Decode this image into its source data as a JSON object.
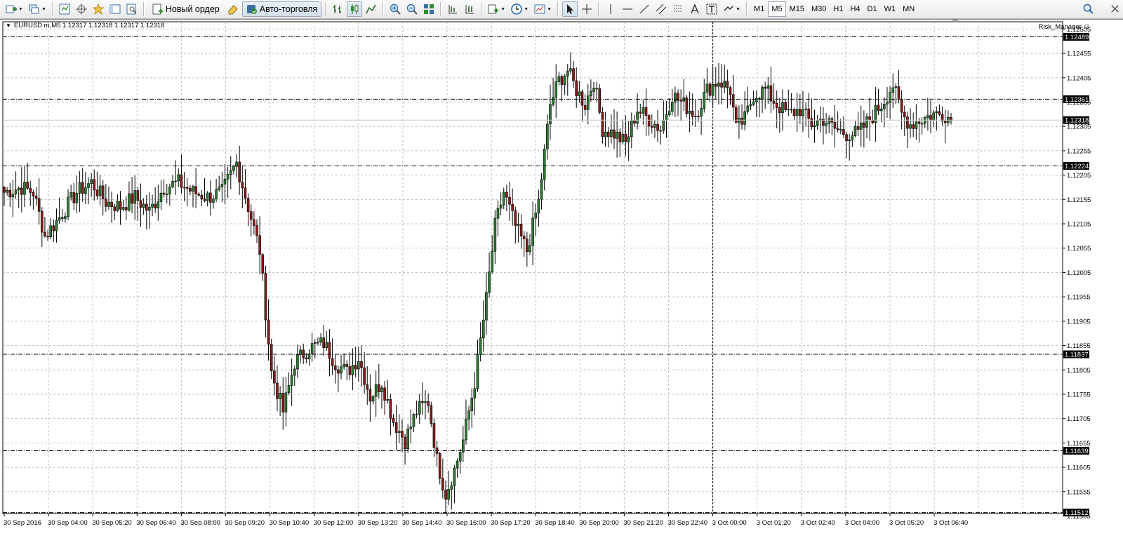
{
  "toolbar": {
    "new_order_label": "Новый ордер",
    "autotrading_label": "Авто-торговля",
    "timeframes": [
      "M1",
      "M5",
      "M15",
      "M30",
      "H1",
      "H4",
      "D1",
      "W1",
      "MN"
    ],
    "active_timeframe": "M5"
  },
  "chart": {
    "symbol_header": "EURUSD.m,M5  1.12317 1.12318 1.12317 1.12318",
    "expert_label": "Risk_Manager",
    "price_min": 1.1151,
    "price_max": 1.1252,
    "price_ticks": [
      1.12505,
      1.12455,
      1.12405,
      1.12355,
      1.12305,
      1.12255,
      1.12205,
      1.12155,
      1.12105,
      1.12055,
      1.12005,
      1.11955,
      1.11905,
      1.11855,
      1.11805,
      1.11755,
      1.11705,
      1.11655,
      1.11605,
      1.11555,
      1.11505
    ],
    "hlines": [
      {
        "price": 1.12489,
        "label": "1.12489"
      },
      {
        "price": 1.12361,
        "label": "1.12361"
      },
      {
        "price": 1.12224,
        "label": "1.12224"
      },
      {
        "price": 1.11837,
        "label": "1.11837"
      },
      {
        "price": 1.11639,
        "label": "1.11639"
      },
      {
        "price": 1.11512,
        "label": "1.11512"
      }
    ],
    "bid": {
      "price": 1.12318,
      "label": "1.12318"
    },
    "time_labels": [
      "30 Sep 2016",
      "30 Sep 04:00",
      "30 Sep 05:20",
      "30 Sep 06:40",
      "30 Sep 08:00",
      "30 Sep 09:20",
      "30 Sep 10:40",
      "30 Sep 12:00",
      "30 Sep 13:20",
      "30 Sep 14:40",
      "30 Sep 16:00",
      "30 Sep 17:20",
      "30 Sep 18:40",
      "30 Sep 20:00",
      "30 Sep 21:20",
      "30 Sep 22:40",
      "3 Oct 00:00",
      "3 Oct 01:20",
      "3 Oct 02:40",
      "3 Oct 04:00",
      "3 Oct 05:20",
      "3 Oct 06:40"
    ],
    "period_separator_index": 16,
    "colors": {
      "bull": "#2e7d32",
      "bear": "#8b1a1a",
      "grid": "#c0c0c0",
      "label_bg": "#000000"
    },
    "anchors": [
      [
        0,
        1.1217
      ],
      [
        6,
        1.1218
      ],
      [
        10,
        1.1217
      ],
      [
        14,
        1.1208
      ],
      [
        18,
        1.1211
      ],
      [
        25,
        1.1217
      ],
      [
        30,
        1.1219
      ],
      [
        35,
        1.1215
      ],
      [
        40,
        1.1214
      ],
      [
        45,
        1.1216
      ],
      [
        50,
        1.1213
      ],
      [
        55,
        1.1218
      ],
      [
        60,
        1.1219
      ],
      [
        65,
        1.1217
      ],
      [
        70,
        1.1216
      ],
      [
        75,
        1.1217
      ],
      [
        80,
        1.1223
      ],
      [
        84,
        1.1214
      ],
      [
        88,
        1.1205
      ],
      [
        92,
        1.118
      ],
      [
        96,
        1.1172
      ],
      [
        100,
        1.1182
      ],
      [
        105,
        1.1185
      ],
      [
        110,
        1.1186
      ],
      [
        114,
        1.1182
      ],
      [
        118,
        1.118
      ],
      [
        122,
        1.1183
      ],
      [
        126,
        1.1175
      ],
      [
        130,
        1.1178
      ],
      [
        134,
        1.117
      ],
      [
        138,
        1.1166
      ],
      [
        142,
        1.1172
      ],
      [
        146,
        1.1174
      ],
      [
        149,
        1.1162
      ],
      [
        152,
        1.1155
      ],
      [
        155,
        1.116
      ],
      [
        158,
        1.1166
      ],
      [
        162,
        1.1178
      ],
      [
        166,
        1.1195
      ],
      [
        169,
        1.121
      ],
      [
        172,
        1.1217
      ],
      [
        176,
        1.121
      ],
      [
        180,
        1.1205
      ],
      [
        184,
        1.1215
      ],
      [
        188,
        1.1235
      ],
      [
        191,
        1.124
      ],
      [
        194,
        1.1242
      ],
      [
        197,
        1.1238
      ],
      [
        200,
        1.1235
      ],
      [
        203,
        1.124
      ],
      [
        206,
        1.123
      ],
      [
        210,
        1.1229
      ],
      [
        214,
        1.1227
      ],
      [
        218,
        1.1234
      ],
      [
        222,
        1.1232
      ],
      [
        226,
        1.123
      ],
      [
        230,
        1.1237
      ],
      [
        234,
        1.1235
      ],
      [
        238,
        1.1233
      ],
      [
        242,
        1.1238
      ],
      [
        246,
        1.124
      ],
      [
        250,
        1.1238
      ],
      [
        252,
        1.123
      ],
      [
        255,
        1.1232
      ],
      [
        258,
        1.1237
      ],
      [
        262,
        1.1238
      ],
      [
        266,
        1.1235
      ],
      [
        270,
        1.1233
      ],
      [
        274,
        1.1234
      ],
      [
        278,
        1.1231
      ],
      [
        282,
        1.1232
      ],
      [
        286,
        1.123
      ],
      [
        290,
        1.1229
      ],
      [
        294,
        1.1229
      ],
      [
        298,
        1.1232
      ],
      [
        302,
        1.1235
      ],
      [
        306,
        1.1239
      ],
      [
        309,
        1.1233
      ],
      [
        312,
        1.1231
      ],
      [
        316,
        1.1232
      ],
      [
        320,
        1.1233
      ],
      [
        324,
        1.1233
      ],
      [
        326,
        1.12318
      ]
    ]
  }
}
